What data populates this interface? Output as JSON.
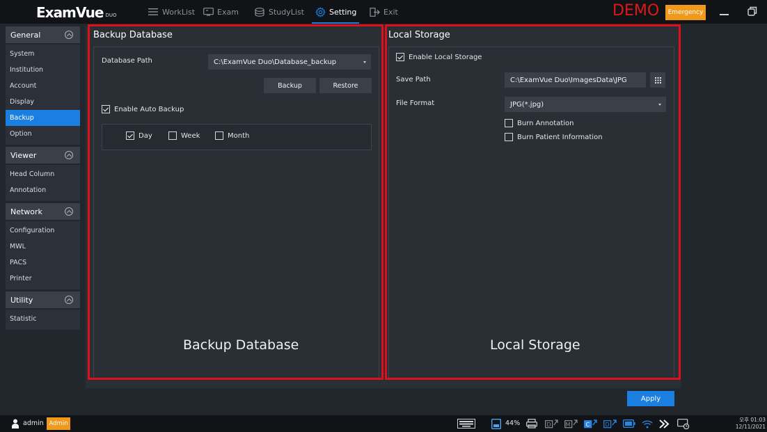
{
  "app": {
    "logo_main": "ExamVue",
    "logo_sub": "DUO",
    "demo_label": "DEMO",
    "emergency_label": "Emergency"
  },
  "nav": [
    {
      "label": "WorkList",
      "icon": "menu-lines-icon",
      "active": false
    },
    {
      "label": "Exam",
      "icon": "monitor-icon",
      "active": false
    },
    {
      "label": "StudyList",
      "icon": "database-icon",
      "active": false
    },
    {
      "label": "Setting",
      "icon": "gear-icon",
      "active": true
    },
    {
      "label": "Exit",
      "icon": "exit-door-icon",
      "active": false
    }
  ],
  "sidebar": {
    "groups": [
      {
        "label": "General",
        "items": [
          "System",
          "Institution",
          "Account",
          "Display",
          "Backup",
          "Option"
        ]
      },
      {
        "label": "Viewer",
        "items": [
          "Head Column",
          "Annotation"
        ]
      },
      {
        "label": "Network",
        "items": [
          "Configuration",
          "MWL",
          "PACS",
          "Printer"
        ]
      },
      {
        "label": "Utility",
        "items": [
          "Statistic"
        ]
      }
    ],
    "active_item": "Backup"
  },
  "backup": {
    "title": "Backup Database",
    "path_label": "Database Path",
    "path_value": "C:\\ExamVue Duo\\Database_backup",
    "backup_button": "Backup",
    "restore_button": "Restore",
    "auto_backup_label": "Enable Auto Backup",
    "auto_backup_checked": true,
    "day_label": "Day",
    "day_checked": true,
    "week_label": "Week",
    "week_checked": false,
    "month_label": "Month",
    "month_checked": false,
    "caption": "Backup Database"
  },
  "storage": {
    "title": "Local Storage",
    "enable_label": "Enable Local Storage",
    "enable_checked": true,
    "save_path_label": "Save Path",
    "save_path_value": "C:\\ExamVue Duo\\ImagesData\\JPG",
    "file_format_label": "File Format",
    "file_format_value": "JPG(*.jpg)",
    "burn_annotation_label": "Burn Annotation",
    "burn_annotation_checked": false,
    "burn_patient_label": "Burn Patient Information",
    "burn_patient_checked": false,
    "caption": "Local Storage"
  },
  "apply_label": "Apply",
  "statusbar": {
    "user": "admin",
    "role": "Admin",
    "battery_percent": "44%",
    "time": "오후 01:03",
    "date": "12/11/2021"
  },
  "colors": {
    "accent": "#1a7fe0",
    "warning": "#ef9a1c",
    "highlight_frame": "#e0101a",
    "demo": "#e01818"
  }
}
